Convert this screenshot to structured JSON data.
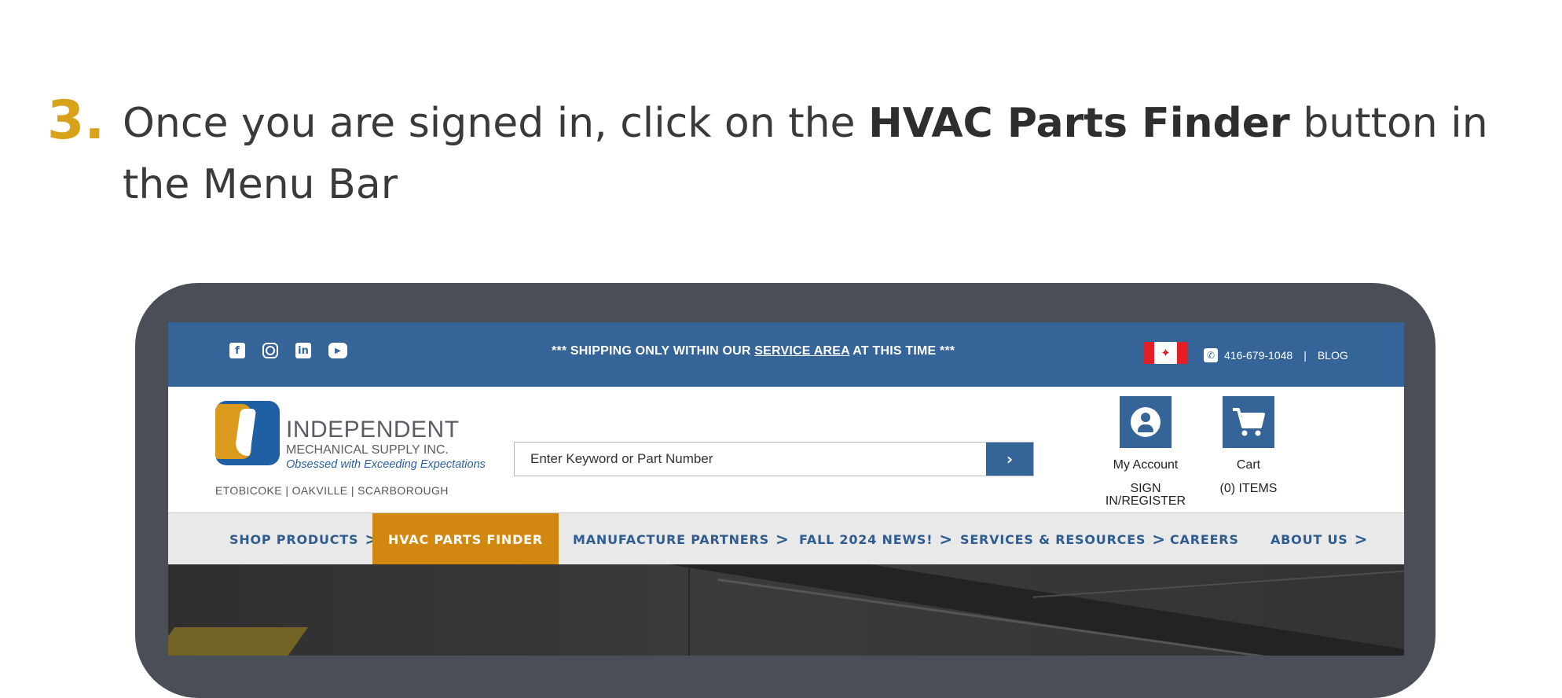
{
  "instruction": {
    "number": "3.",
    "text_before": "Once you are signed in, click on the ",
    "text_bold": "HVAC Parts Finder",
    "text_after": " button in the Menu Bar"
  },
  "colors": {
    "accent_gold": "#d9a21b",
    "brand_blue": "#346498",
    "active_orange": "#d28710",
    "frame_gray": "#4a4e56"
  },
  "topbar": {
    "social_icons": [
      "facebook-icon",
      "instagram-icon",
      "linkedin-icon",
      "youtube-icon"
    ],
    "shipping_prefix": "*** SHIPPING ONLY WITHIN OUR ",
    "shipping_link": "SERVICE AREA",
    "shipping_suffix": " AT THIS TIME ***",
    "phone": "416-679-1048",
    "separator": "|",
    "blog": "BLOG"
  },
  "header": {
    "logo_name": "INDEPENDENT",
    "logo_sub": "MECHANICAL SUPPLY INC.",
    "logo_tagline": "Obsessed with Exceeding Expectations",
    "locations": "ETOBICOKE | OAKVILLE | SCARBOROUGH",
    "search_placeholder": "Enter Keyword or Part Number",
    "account_label": "My Account",
    "account_action": "SIGN IN/REGISTER",
    "cart_label": "Cart",
    "cart_count": "(0) ITEMS"
  },
  "nav": {
    "items": [
      {
        "label": "SHOP PRODUCTS",
        "chevron": ">"
      },
      {
        "label": "HVAC PARTS FINDER",
        "chevron": ""
      },
      {
        "label": "MANUFACTURE PARTNERS",
        "chevron": ">"
      },
      {
        "label": "FALL 2024 NEWS!",
        "chevron": ">"
      },
      {
        "label": "SERVICES & RESOURCES",
        "chevron": ">"
      },
      {
        "label": "CAREERS",
        "chevron": ""
      },
      {
        "label": "ABOUT US",
        "chevron": ">"
      }
    ]
  }
}
